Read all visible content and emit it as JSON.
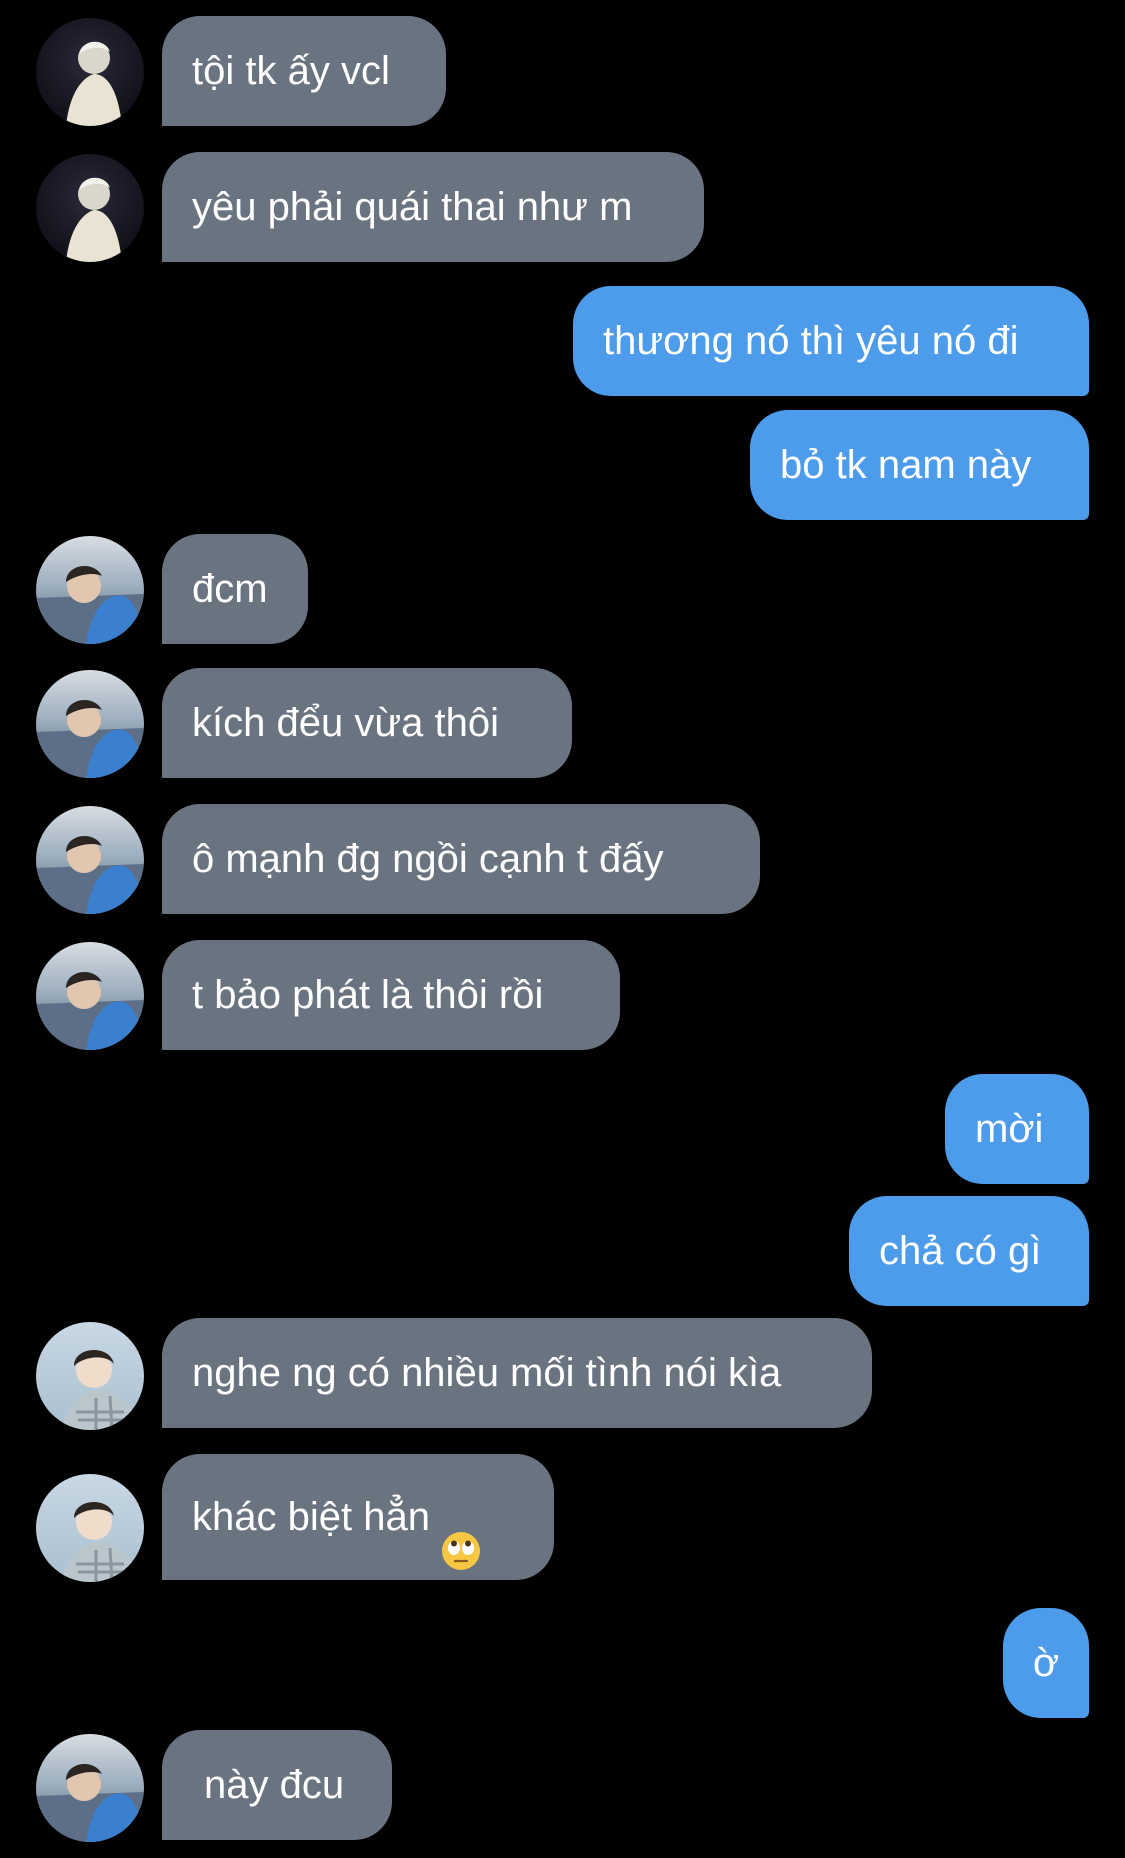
{
  "conversation": {
    "messages": [
      {
        "sender": "them",
        "text": "tội tk ấy vcl"
      },
      {
        "sender": "them",
        "text": "yêu phải quái thai như m"
      },
      {
        "sender": "me",
        "text": "thương nó thì yêu nó đi"
      },
      {
        "sender": "me",
        "text": "bỏ tk nam này"
      },
      {
        "sender": "them",
        "text": "đcm"
      },
      {
        "sender": "them",
        "text": "kích đểu vừa thôi"
      },
      {
        "sender": "them",
        "text": "ô mạnh đg ngồi cạnh t đấy"
      },
      {
        "sender": "them",
        "text": "t bảo phát là thôi rồi"
      },
      {
        "sender": "me",
        "text": "mời"
      },
      {
        "sender": "me",
        "text": "chả có gì"
      },
      {
        "sender": "them",
        "text": "nghe ng có nhiều mối tình nói kìa"
      },
      {
        "sender": "them",
        "text": "khác biệt hẳn",
        "emoji": "eye-roll-emoji"
      },
      {
        "sender": "me",
        "text": "ờ"
      },
      {
        "sender": "them",
        "text": "này đcu"
      }
    ]
  },
  "colors": {
    "background": "#000000",
    "incoming_bubble": "#6a7480",
    "outgoing_bubble": "#4c9ceb",
    "text": "#ffffff"
  }
}
